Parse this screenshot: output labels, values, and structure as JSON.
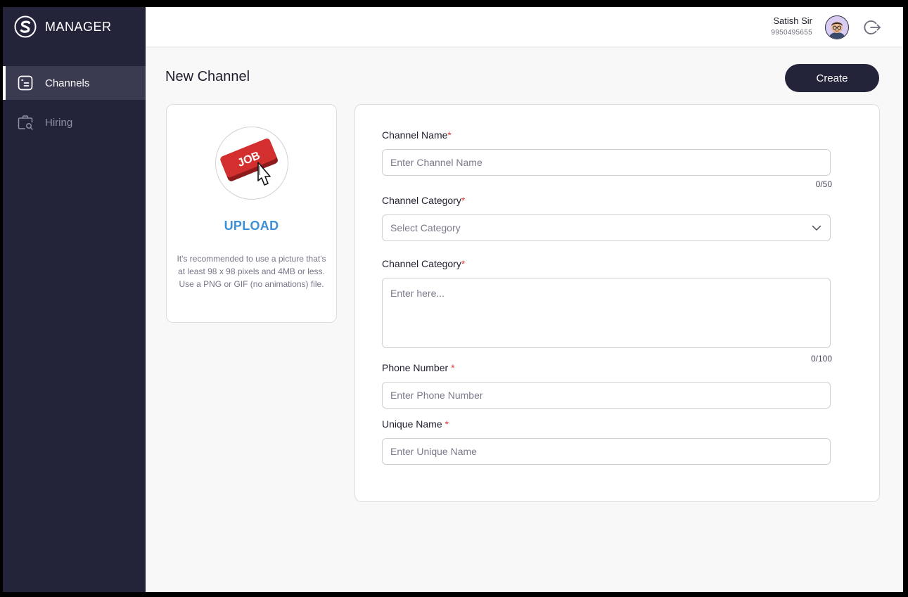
{
  "brand": {
    "name": "MANAGER",
    "logo_icon": "s-logo-icon"
  },
  "sidebar": {
    "items": [
      {
        "label": "Channels",
        "icon": "list-icon",
        "active": true
      },
      {
        "label": "Hiring",
        "icon": "briefcase-search-icon",
        "active": false
      }
    ]
  },
  "header": {
    "user_name": "Satish Sir",
    "user_phone": "9950495655",
    "avatar_icon": "avatar",
    "logout_icon": "logout-icon"
  },
  "page": {
    "title": "New Channel",
    "create_label": "Create"
  },
  "upload": {
    "image_text": "JOB",
    "label": "UPLOAD",
    "hint": "It's recommended to use a picture that's at least 98 x 98 pixels and 4MB or less. Use a PNG or GIF (no animations) file."
  },
  "form": {
    "channel_name": {
      "label": "Channel Name",
      "required": "*",
      "placeholder": "Enter Channel Name",
      "counter": "0/50"
    },
    "channel_category": {
      "label": "Channel Category",
      "required": "*",
      "placeholder": "Select Category"
    },
    "channel_description": {
      "label": "Channel Category",
      "required": "*",
      "placeholder": "Enter here...",
      "counter": "0/100"
    },
    "phone_number": {
      "label": "Phone Number ",
      "required": "*",
      "placeholder": "Enter Phone Number"
    },
    "unique_name": {
      "label": "Unique Name ",
      "required": "*",
      "placeholder": "Enter Unique Name"
    }
  },
  "colors": {
    "sidebar_bg": "#23233a",
    "accent_blue": "#3d8fd6",
    "required_red": "#e53935",
    "button_bg": "#23233a"
  }
}
